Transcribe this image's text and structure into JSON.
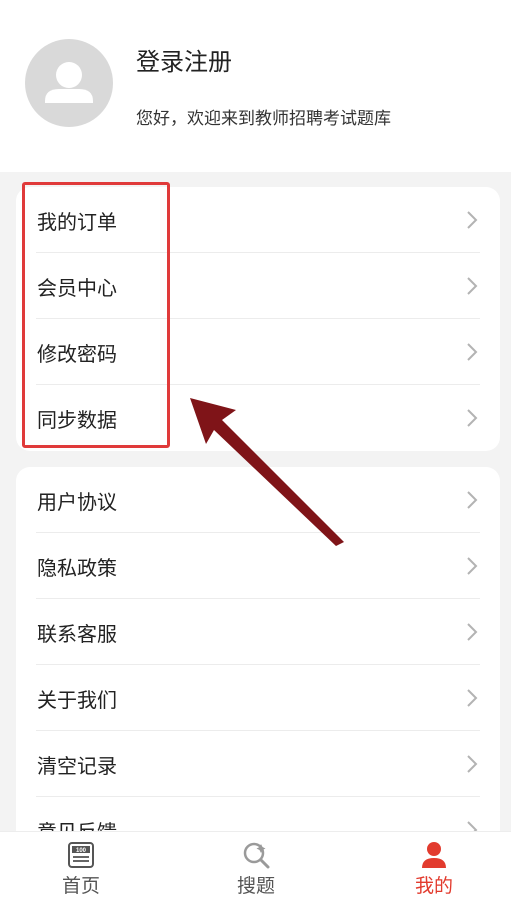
{
  "profile": {
    "login_label": "登录注册",
    "welcome_text": "您好，欢迎来到教师招聘考试题库"
  },
  "menu_group_1": [
    {
      "label": "我的订单"
    },
    {
      "label": "会员中心"
    },
    {
      "label": "修改密码"
    },
    {
      "label": "同步数据"
    }
  ],
  "menu_group_2": [
    {
      "label": "用户协议"
    },
    {
      "label": "隐私政策"
    },
    {
      "label": "联系客服"
    },
    {
      "label": "关于我们"
    },
    {
      "label": "清空记录"
    },
    {
      "label": "意见反馈"
    }
  ],
  "tabbar": {
    "items": [
      {
        "label": "首页",
        "icon": "exam-book-icon"
      },
      {
        "label": "搜题",
        "icon": "search-question-icon"
      },
      {
        "label": "我的",
        "icon": "user-icon",
        "active": true
      }
    ]
  },
  "colors": {
    "accent": "#e23b2e",
    "highlight": "#e03a3a",
    "arrow": "#7f1418",
    "background": "#f3f3f3"
  }
}
